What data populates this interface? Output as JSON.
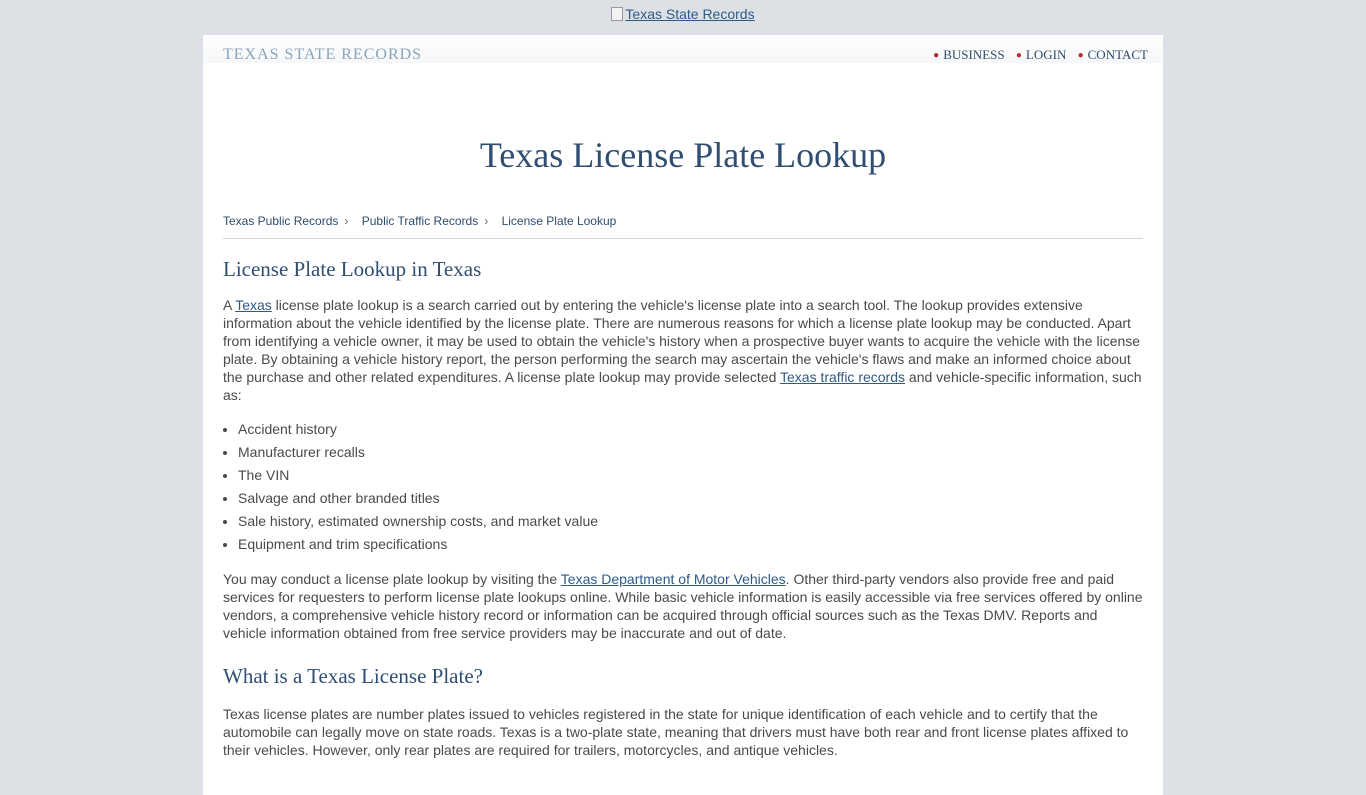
{
  "top_logo": {
    "alt": "Texas State Records"
  },
  "header": {
    "brand": "TEXAS STATE RECORDS",
    "nav": [
      "BUSINESS",
      "LOGIN",
      "CONTACT"
    ]
  },
  "page_title": "Texas License Plate Lookup",
  "breadcrumb": [
    "Texas Public Records",
    "Public Traffic Records",
    "License Plate Lookup"
  ],
  "section1": {
    "heading": "License Plate Lookup in Texas",
    "p1_a": "A ",
    "p1_link1": "Texas",
    "p1_b": " license plate lookup is a search carried out by entering the vehicle's license plate into a search tool. The lookup provides extensive information about the vehicle identified by the license plate. There are numerous reasons for which a license plate lookup may be conducted. Apart from identifying a vehicle owner, it may be used to obtain the vehicle's history when a prospective buyer wants to acquire the vehicle with the license plate. By obtaining a vehicle history report, the person performing the search may ascertain the vehicle's flaws and make an informed choice about the purchase and other related expenditures. A license plate lookup may provide selected ",
    "p1_link2": "Texas traffic records",
    "p1_c": " and vehicle-specific information, such as:",
    "list": [
      "Accident history",
      "Manufacturer recalls",
      "The VIN",
      "Salvage and other branded titles",
      "Sale history, estimated ownership costs, and market value",
      "Equipment and trim specifications"
    ],
    "p2_a": "You may conduct a license plate lookup by visiting the ",
    "p2_link": "Texas Department of Motor Vehicles",
    "p2_b": ". Other third-party vendors also provide free and paid services for requesters to perform license plate lookups online. While basic vehicle information is easily accessible via free services offered by online vendors, a comprehensive vehicle history record or information can be acquired through official sources such as the Texas DMV. Reports and vehicle information obtained from free service providers may be inaccurate and out of date."
  },
  "section2": {
    "heading": "What is a Texas License Plate?",
    "p1": "Texas license plates are number plates issued to vehicles registered in the state for unique identification of each vehicle and to certify that the automobile can legally move on state roads. Texas is a two-plate state, meaning that drivers must have both rear and front license plates affixed to their vehicles. However, only rear plates are required for trailers, motorcycles, and antique vehicles."
  }
}
